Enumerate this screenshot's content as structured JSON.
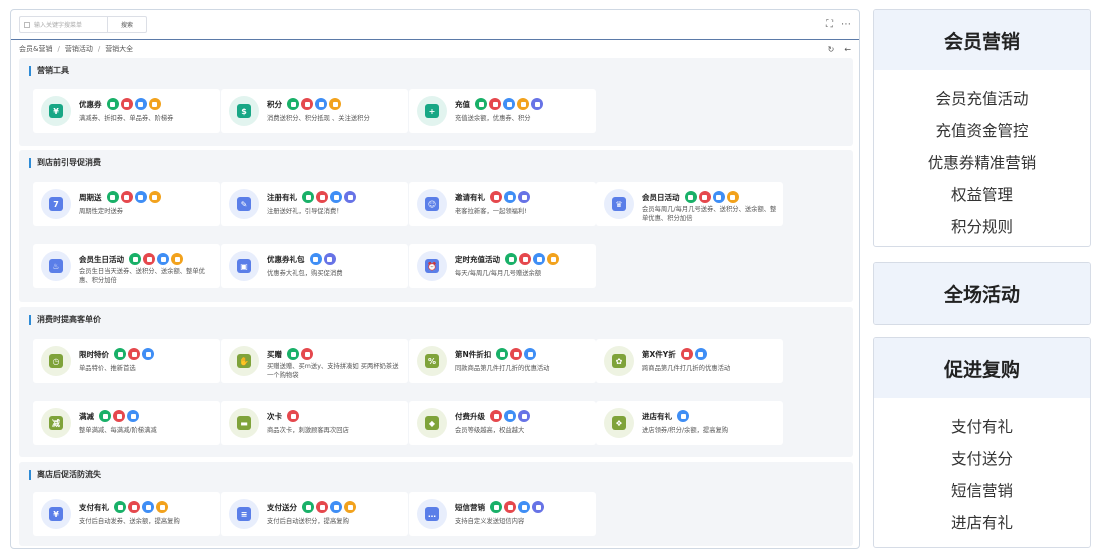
{
  "search": {
    "placeholder": "输入关键字搜菜单",
    "button": "搜索"
  },
  "breadcrumb": [
    "会员&营销",
    "营销活动",
    "营销大全"
  ],
  "sections": [
    {
      "title": "营销工具"
    },
    {
      "title": "到店前引导促消费"
    },
    {
      "title": "消费时提高客单价"
    },
    {
      "title": "离店后促活防流失"
    }
  ],
  "cards": {
    "coupon": {
      "name": "优惠券",
      "desc": "满减券、折扣券、单品券、阶梯券"
    },
    "points": {
      "name": "积分",
      "desc": "消费送积分、积分抵现 、关注送积分"
    },
    "recharge": {
      "name": "充值",
      "desc": "充值送余额，优惠券、积分"
    },
    "weekly": {
      "name": "周期送",
      "desc": "周期性定时送券"
    },
    "register": {
      "name": "注册有礼",
      "desc": "注册送好礼，引导促消费！"
    },
    "invite": {
      "name": "邀请有礼",
      "desc": "老客拉新客，一起领福利!"
    },
    "member_day": {
      "name": "会员日活动",
      "desc": "会员每周几/每月几号送券、送积分、送余额、整单优惠、积分加倍"
    },
    "birthday": {
      "name": "会员生日活动",
      "desc": "会员生日当天送券、送积分、送余额、整单优惠、积分加倍"
    },
    "coupon_pack": {
      "name": "优惠券礼包",
      "desc": "优惠券大礼包，购买促消费"
    },
    "timed_recharge": {
      "name": "定时充值活动",
      "desc": "每天/每周几/每月几号赠送余额"
    },
    "flash_price": {
      "name": "限时特价",
      "desc": "单品特价、推新首选"
    },
    "gift": {
      "name": "买赠",
      "desc": "买赠送赠、买m送y、支持拼凑如 买两杯奶茶送一个购物袋"
    },
    "nth_discount": {
      "name": "第N件折扣",
      "desc": "同款商品第几件打几折的优惠活动"
    },
    "xy_discount": {
      "name": "第X件Y折",
      "desc": "跨商品第几件打几折的优惠活动"
    },
    "full_reduce": {
      "name": "满减",
      "desc": "整单满减、每满减/阶梯满减"
    },
    "times_card": {
      "name": "次卡",
      "desc": "商品次卡，刺激顾客再次回店"
    },
    "paid_upgrade": {
      "name": "付费升级",
      "desc": "会员等级越高，权益越大"
    },
    "visit_gift": {
      "name": "进店有礼",
      "desc": "进店领券/积分/余额，提高复购"
    },
    "pay_gift": {
      "name": "支付有礼",
      "desc": "支付后自动发券、送余额，提高复购"
    },
    "pay_points": {
      "name": "支付送分",
      "desc": "支付后自动送积分，提高复购"
    },
    "sms": {
      "name": "短信营销",
      "desc": "支持自定义发送短信内容"
    }
  },
  "right_panels": {
    "member": {
      "title": "会员营销",
      "items": [
        "会员充值活动",
        "充值资金管控",
        "优惠券精准营销",
        "权益管理",
        "积分规则"
      ]
    },
    "store_wide": {
      "title": "全场活动"
    },
    "repurchase": {
      "title": "促进复购",
      "items": [
        "支付有礼",
        "支付送分",
        "短信营销",
        "进店有礼"
      ]
    }
  },
  "colors": {
    "accent": "#2e8bd6",
    "green": "#19b068",
    "red": "#e5484d",
    "blue": "#3f8ef5",
    "orange": "#f2a21d",
    "indigo": "#6773e6"
  }
}
